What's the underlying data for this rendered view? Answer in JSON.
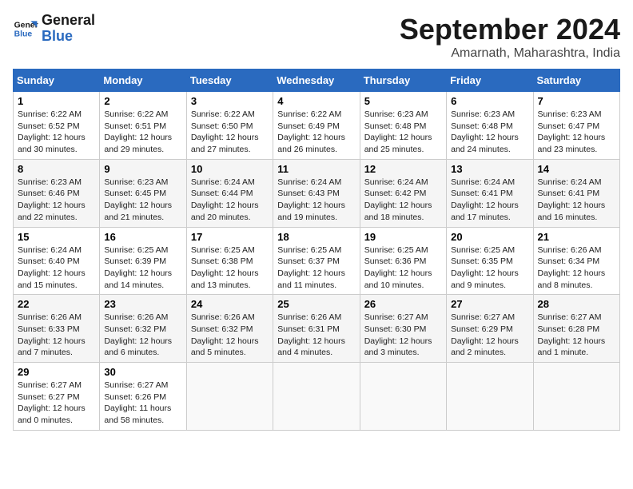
{
  "logo": {
    "line1": "General",
    "line2": "Blue"
  },
  "title": "September 2024",
  "location": "Amarnath, Maharashtra, India",
  "headers": [
    "Sunday",
    "Monday",
    "Tuesday",
    "Wednesday",
    "Thursday",
    "Friday",
    "Saturday"
  ],
  "weeks": [
    [
      {
        "day": "1",
        "detail": "Sunrise: 6:22 AM\nSunset: 6:52 PM\nDaylight: 12 hours\nand 30 minutes."
      },
      {
        "day": "2",
        "detail": "Sunrise: 6:22 AM\nSunset: 6:51 PM\nDaylight: 12 hours\nand 29 minutes."
      },
      {
        "day": "3",
        "detail": "Sunrise: 6:22 AM\nSunset: 6:50 PM\nDaylight: 12 hours\nand 27 minutes."
      },
      {
        "day": "4",
        "detail": "Sunrise: 6:22 AM\nSunset: 6:49 PM\nDaylight: 12 hours\nand 26 minutes."
      },
      {
        "day": "5",
        "detail": "Sunrise: 6:23 AM\nSunset: 6:48 PM\nDaylight: 12 hours\nand 25 minutes."
      },
      {
        "day": "6",
        "detail": "Sunrise: 6:23 AM\nSunset: 6:48 PM\nDaylight: 12 hours\nand 24 minutes."
      },
      {
        "day": "7",
        "detail": "Sunrise: 6:23 AM\nSunset: 6:47 PM\nDaylight: 12 hours\nand 23 minutes."
      }
    ],
    [
      {
        "day": "8",
        "detail": "Sunrise: 6:23 AM\nSunset: 6:46 PM\nDaylight: 12 hours\nand 22 minutes."
      },
      {
        "day": "9",
        "detail": "Sunrise: 6:23 AM\nSunset: 6:45 PM\nDaylight: 12 hours\nand 21 minutes."
      },
      {
        "day": "10",
        "detail": "Sunrise: 6:24 AM\nSunset: 6:44 PM\nDaylight: 12 hours\nand 20 minutes."
      },
      {
        "day": "11",
        "detail": "Sunrise: 6:24 AM\nSunset: 6:43 PM\nDaylight: 12 hours\nand 19 minutes."
      },
      {
        "day": "12",
        "detail": "Sunrise: 6:24 AM\nSunset: 6:42 PM\nDaylight: 12 hours\nand 18 minutes."
      },
      {
        "day": "13",
        "detail": "Sunrise: 6:24 AM\nSunset: 6:41 PM\nDaylight: 12 hours\nand 17 minutes."
      },
      {
        "day": "14",
        "detail": "Sunrise: 6:24 AM\nSunset: 6:41 PM\nDaylight: 12 hours\nand 16 minutes."
      }
    ],
    [
      {
        "day": "15",
        "detail": "Sunrise: 6:24 AM\nSunset: 6:40 PM\nDaylight: 12 hours\nand 15 minutes."
      },
      {
        "day": "16",
        "detail": "Sunrise: 6:25 AM\nSunset: 6:39 PM\nDaylight: 12 hours\nand 14 minutes."
      },
      {
        "day": "17",
        "detail": "Sunrise: 6:25 AM\nSunset: 6:38 PM\nDaylight: 12 hours\nand 13 minutes."
      },
      {
        "day": "18",
        "detail": "Sunrise: 6:25 AM\nSunset: 6:37 PM\nDaylight: 12 hours\nand 11 minutes."
      },
      {
        "day": "19",
        "detail": "Sunrise: 6:25 AM\nSunset: 6:36 PM\nDaylight: 12 hours\nand 10 minutes."
      },
      {
        "day": "20",
        "detail": "Sunrise: 6:25 AM\nSunset: 6:35 PM\nDaylight: 12 hours\nand 9 minutes."
      },
      {
        "day": "21",
        "detail": "Sunrise: 6:26 AM\nSunset: 6:34 PM\nDaylight: 12 hours\nand 8 minutes."
      }
    ],
    [
      {
        "day": "22",
        "detail": "Sunrise: 6:26 AM\nSunset: 6:33 PM\nDaylight: 12 hours\nand 7 minutes."
      },
      {
        "day": "23",
        "detail": "Sunrise: 6:26 AM\nSunset: 6:32 PM\nDaylight: 12 hours\nand 6 minutes."
      },
      {
        "day": "24",
        "detail": "Sunrise: 6:26 AM\nSunset: 6:32 PM\nDaylight: 12 hours\nand 5 minutes."
      },
      {
        "day": "25",
        "detail": "Sunrise: 6:26 AM\nSunset: 6:31 PM\nDaylight: 12 hours\nand 4 minutes."
      },
      {
        "day": "26",
        "detail": "Sunrise: 6:27 AM\nSunset: 6:30 PM\nDaylight: 12 hours\nand 3 minutes."
      },
      {
        "day": "27",
        "detail": "Sunrise: 6:27 AM\nSunset: 6:29 PM\nDaylight: 12 hours\nand 2 minutes."
      },
      {
        "day": "28",
        "detail": "Sunrise: 6:27 AM\nSunset: 6:28 PM\nDaylight: 12 hours\nand 1 minute."
      }
    ],
    [
      {
        "day": "29",
        "detail": "Sunrise: 6:27 AM\nSunset: 6:27 PM\nDaylight: 12 hours\nand 0 minutes."
      },
      {
        "day": "30",
        "detail": "Sunrise: 6:27 AM\nSunset: 6:26 PM\nDaylight: 11 hours\nand 58 minutes."
      },
      {
        "day": "",
        "detail": ""
      },
      {
        "day": "",
        "detail": ""
      },
      {
        "day": "",
        "detail": ""
      },
      {
        "day": "",
        "detail": ""
      },
      {
        "day": "",
        "detail": ""
      }
    ]
  ]
}
